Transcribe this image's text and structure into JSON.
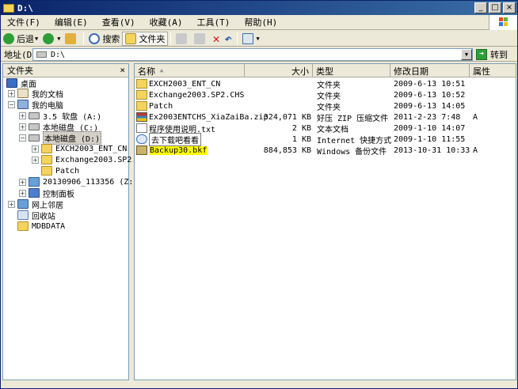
{
  "window": {
    "title": "D:\\",
    "buttons": {
      "minimize": "_",
      "maximize": "□",
      "close": "×"
    }
  },
  "menu": [
    "文件(F)",
    "编辑(E)",
    "查看(V)",
    "收藏(A)",
    "工具(T)",
    "帮助(H)"
  ],
  "toolbar": {
    "back": "后退",
    "search": "搜索",
    "folders": "文件夹"
  },
  "address": {
    "label": "地址(D)",
    "value": "D:\\",
    "go": "转到"
  },
  "folders_pane": {
    "title": "文件夹",
    "close": "×",
    "tree": [
      {
        "label": "桌面",
        "icon": "desktop-icon"
      },
      {
        "label": "我的文档",
        "icon": "documents-icon"
      },
      {
        "label": "我的电脑",
        "icon": "computer-icon"
      },
      {
        "label": "3.5 软盘 (A:)",
        "icon": "floppy-icon"
      },
      {
        "label": "本地磁盘 (C:)",
        "icon": "drive-icon"
      },
      {
        "label": "本地磁盘 (D:)",
        "icon": "drive-icon"
      },
      {
        "label": "EXCH2003_ENT_CN",
        "icon": "folder-icon"
      },
      {
        "label": "Exchange2003.SP2.CHS",
        "icon": "folder-icon"
      },
      {
        "label": "Patch",
        "icon": "folder-icon"
      },
      {
        "label": "20130906_113356 (Z:)",
        "icon": "network-drive-icon"
      },
      {
        "label": "控制面板",
        "icon": "control-panel-icon"
      },
      {
        "label": "网上邻居",
        "icon": "network-icon"
      },
      {
        "label": "回收站",
        "icon": "recycle-bin-icon"
      },
      {
        "label": "MDBDATA",
        "icon": "folder-icon"
      }
    ]
  },
  "files": {
    "columns": {
      "name": "名称",
      "size": "大小",
      "type": "类型",
      "modified": "修改日期",
      "attributes": "属性"
    },
    "rows": [
      {
        "name": "EXCH2003_ENT_CN",
        "size": "",
        "type": "文件夹",
        "modified": "2009-6-13 10:51",
        "attr": "",
        "icon": "folder-icon"
      },
      {
        "name": "Exchange2003.SP2.CHS",
        "size": "",
        "type": "文件夹",
        "modified": "2009-6-13 10:52",
        "attr": "",
        "icon": "folder-icon"
      },
      {
        "name": "Patch",
        "size": "",
        "type": "文件夹",
        "modified": "2009-6-13 14:05",
        "attr": "",
        "icon": "folder-icon"
      },
      {
        "name": "Ex2003ENTCHS_XiaZaiBa.zip",
        "size": "324,071 KB",
        "type": "好压 ZIP 压缩文件",
        "modified": "2011-2-23 7:48",
        "attr": "A",
        "icon": "zip-icon"
      },
      {
        "name": "程序使用说明.txt",
        "size": "2 KB",
        "type": "文本文档",
        "modified": "2009-1-10 14:07",
        "attr": "",
        "icon": "text-file-icon"
      },
      {
        "name": "去下载吧看看",
        "size": "1 KB",
        "type": "Internet 快捷方式",
        "modified": "2009-1-10 11:55",
        "attr": "",
        "icon": "internet-shortcut-icon"
      },
      {
        "name": "Backup30.bkf",
        "size": "884,853 KB",
        "type": "Windows 备份文件",
        "modified": "2013-10-31 10:33",
        "attr": "A",
        "icon": "backup-file-icon"
      }
    ]
  }
}
